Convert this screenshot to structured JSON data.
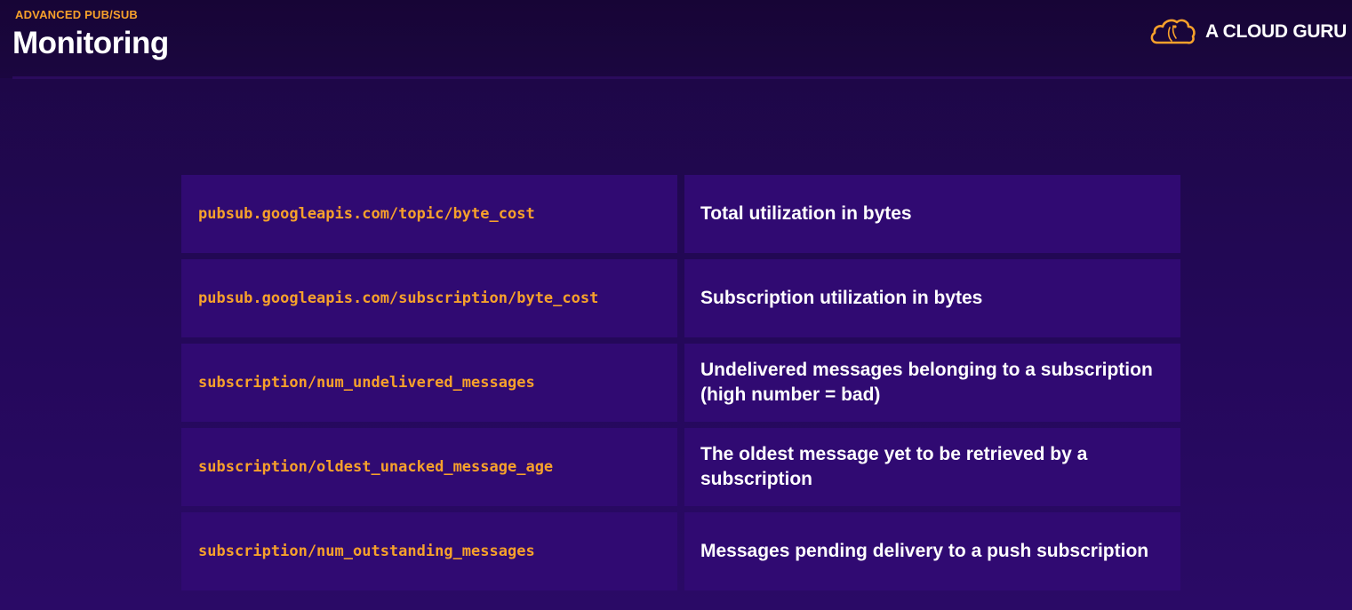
{
  "header": {
    "section_label": "ADVANCED PUB/SUB",
    "title": "Monitoring",
    "logo_text": "A CLOUD GURU",
    "logo_icon": "cloud-icon"
  },
  "colors": {
    "accent": "#f7a12b",
    "background": "#24085a",
    "cell_background": "#300a72",
    "text": "#ffffff"
  },
  "metrics": [
    {
      "name": "pubsub.googleapis.com/topic/byte_cost",
      "description": "Total utilization in bytes"
    },
    {
      "name": "pubsub.googleapis.com/subscription/byte_cost",
      "description": "Subscription utilization in bytes"
    },
    {
      "name": "subscription/num_undelivered_messages",
      "description": "Undelivered messages belonging to a subscription (high number = bad)"
    },
    {
      "name": "subscription/oldest_unacked_message_age",
      "description": "The oldest message yet to be retrieved by a subscription"
    },
    {
      "name": "subscription/num_outstanding_messages",
      "description": "Messages pending delivery to a push subscription"
    }
  ]
}
